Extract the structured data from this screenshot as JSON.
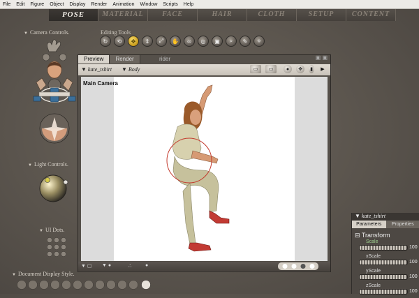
{
  "menu": [
    "File",
    "Edit",
    "Figure",
    "Object",
    "Display",
    "Render",
    "Animation",
    "Window",
    "Scripts",
    "Help"
  ],
  "rooms": [
    "POSE",
    "MATERIAL",
    "FACE",
    "HAIR",
    "CLOTH",
    "SETUP",
    "CONTENT"
  ],
  "active_room": "POSE",
  "camera_controls_label": "Camera Controls.",
  "light_controls_label": "Light Controls.",
  "ui_dots_label": "UI Dots.",
  "doc_display_style_label": "Document Display Style.",
  "editing_tools_label": "Editing Tools",
  "editing_tools": [
    "rotate-icon",
    "twist-icon",
    "translate-icon",
    "translate-in-out-icon",
    "scale-icon",
    "taper-icon",
    "chain-break-icon",
    "color-icon",
    "grouping-icon",
    "view-magnifier-icon",
    "morphing-tool-icon",
    "direct-manipulation-icon"
  ],
  "document": {
    "tabs": [
      "Preview",
      "Render"
    ],
    "extra_tab_text": "rider",
    "figure_select": "kate_tshirt",
    "part_select": "Body",
    "camera_label": "Main Camera"
  },
  "parameters_panel": {
    "title": "kate_tshirt",
    "tabs": [
      "Parameters",
      "Properties"
    ],
    "group": "Transform",
    "params": [
      {
        "name": "Scale",
        "value": "100"
      },
      {
        "name": "xScale",
        "value": "100"
      },
      {
        "name": "yScale",
        "value": "100"
      },
      {
        "name": "zScale",
        "value": "100"
      }
    ]
  },
  "colors": {
    "accent": "#e4c24a",
    "bg": "#5a544d",
    "selection_circle": "#c33b2e"
  }
}
